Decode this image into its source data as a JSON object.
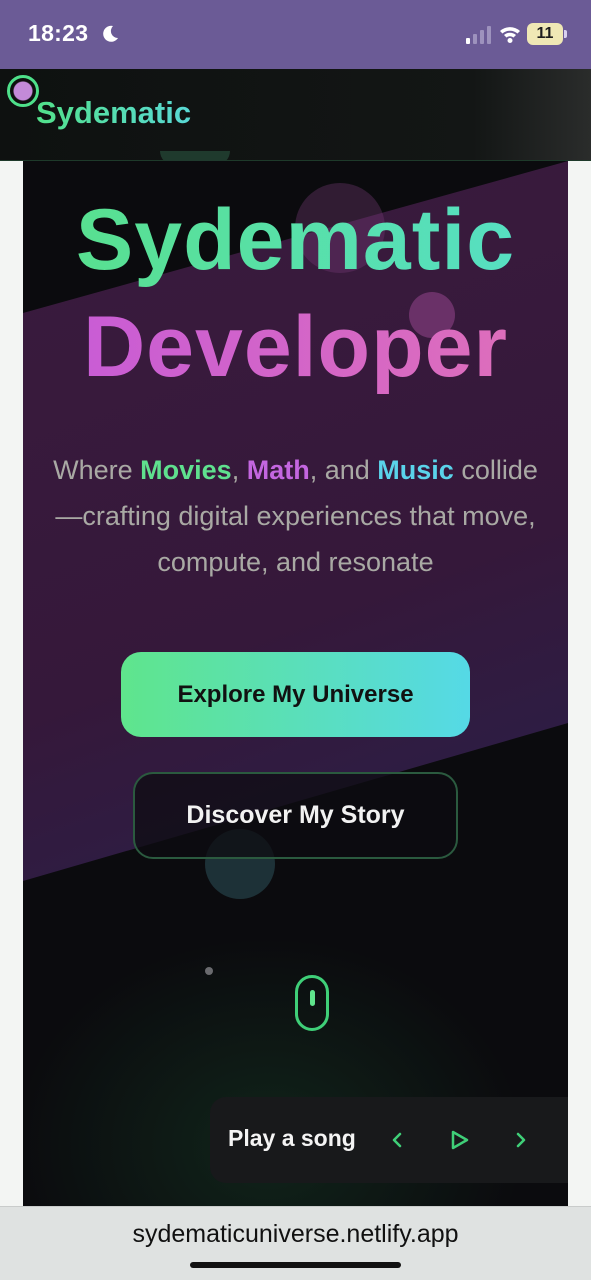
{
  "status_bar": {
    "time": "18:23",
    "moon_icon": "moon-icon",
    "signal_icon": "signal-icon",
    "wifi_icon": "wifi-icon",
    "battery": "11"
  },
  "header": {
    "logo_text": "Sydematic",
    "logo_icon": "orb-icon"
  },
  "hero": {
    "title_line1": "Sydematic",
    "title_line2": "Developer",
    "desc_where": "Where ",
    "desc_movies": "Movies",
    "desc_comma": ", ",
    "desc_math": "Math",
    "desc_and": ", and ",
    "desc_music": "Music",
    "desc_rest": " collide —crafting digital experiences that move, compute, and resonate",
    "primary_button": "Explore My Universe",
    "secondary_button": "Discover My Story",
    "scroll_icon": "mouse-scroll-icon"
  },
  "player": {
    "label": "Play a song",
    "prev_icon": "chevron-left-icon",
    "play_icon": "play-icon",
    "next_icon": "chevron-right-icon"
  },
  "browser": {
    "url": "sydematicuniverse.netlify.app"
  },
  "colors": {
    "status_bar": "#6b5b96",
    "accent_green": "#5fe08e",
    "accent_purple": "#c466e0",
    "accent_cyan": "#5ad3ea",
    "hero_bg": "#0b0b0e"
  }
}
